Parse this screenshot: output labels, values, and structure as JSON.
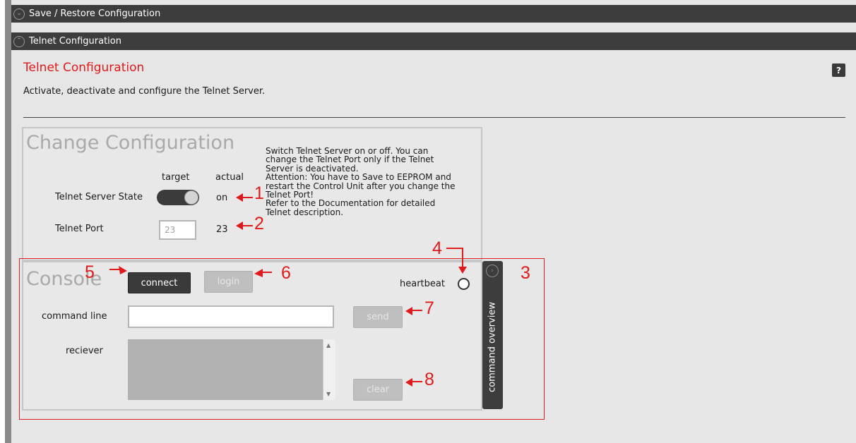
{
  "accordion": {
    "save_restore_label": "Save / Restore Configuration",
    "telnet_label": "Telnet Configuration"
  },
  "section": {
    "title": "Telnet Configuration",
    "description": "Activate, deactivate and configure the Telnet Server.",
    "help_label": "?"
  },
  "change_config": {
    "heading": "Change Configuration",
    "col_target": "target",
    "col_actual": "actual",
    "server_state_label": "Telnet Server State",
    "server_state_target": "on",
    "server_state_actual": "on",
    "port_label": "Telnet Port",
    "port_value": "23",
    "port_actual": "23",
    "help_lines": [
      "Switch Telnet Server on or off. You can",
      "change the Telnet Port only if the Telnet",
      "Server is deactivated.",
      "Attention: You have to Save to EEPROM and",
      "restart the Control Unit after you change the",
      "Telnet Port!",
      "Refer to the Documentation for detailed",
      "Telnet description."
    ]
  },
  "console": {
    "heading": "Console",
    "connect_label": "connect",
    "login_label": "login",
    "heartbeat_label": "heartbeat",
    "command_line_label": "command line",
    "command_line_value": "",
    "send_label": "send",
    "receiver_label": "reciever",
    "clear_label": "clear",
    "command_overview_label": "command overview"
  },
  "annotations": {
    "n1": "1",
    "n2": "2",
    "n3": "3",
    "n4": "4",
    "n5": "5",
    "n6": "6",
    "n7": "7",
    "n8": "8"
  },
  "colors": {
    "title_red": "#e01a1a",
    "dark_bar": "#3d3d3d",
    "panel_bg": "#e6e6e6"
  },
  "icons": {
    "accordion_collapsed": "chevron-down-circle-icon",
    "accordion_expanded": "chevron-up-circle-icon",
    "command_overview": "chevron-right-circle-icon"
  }
}
